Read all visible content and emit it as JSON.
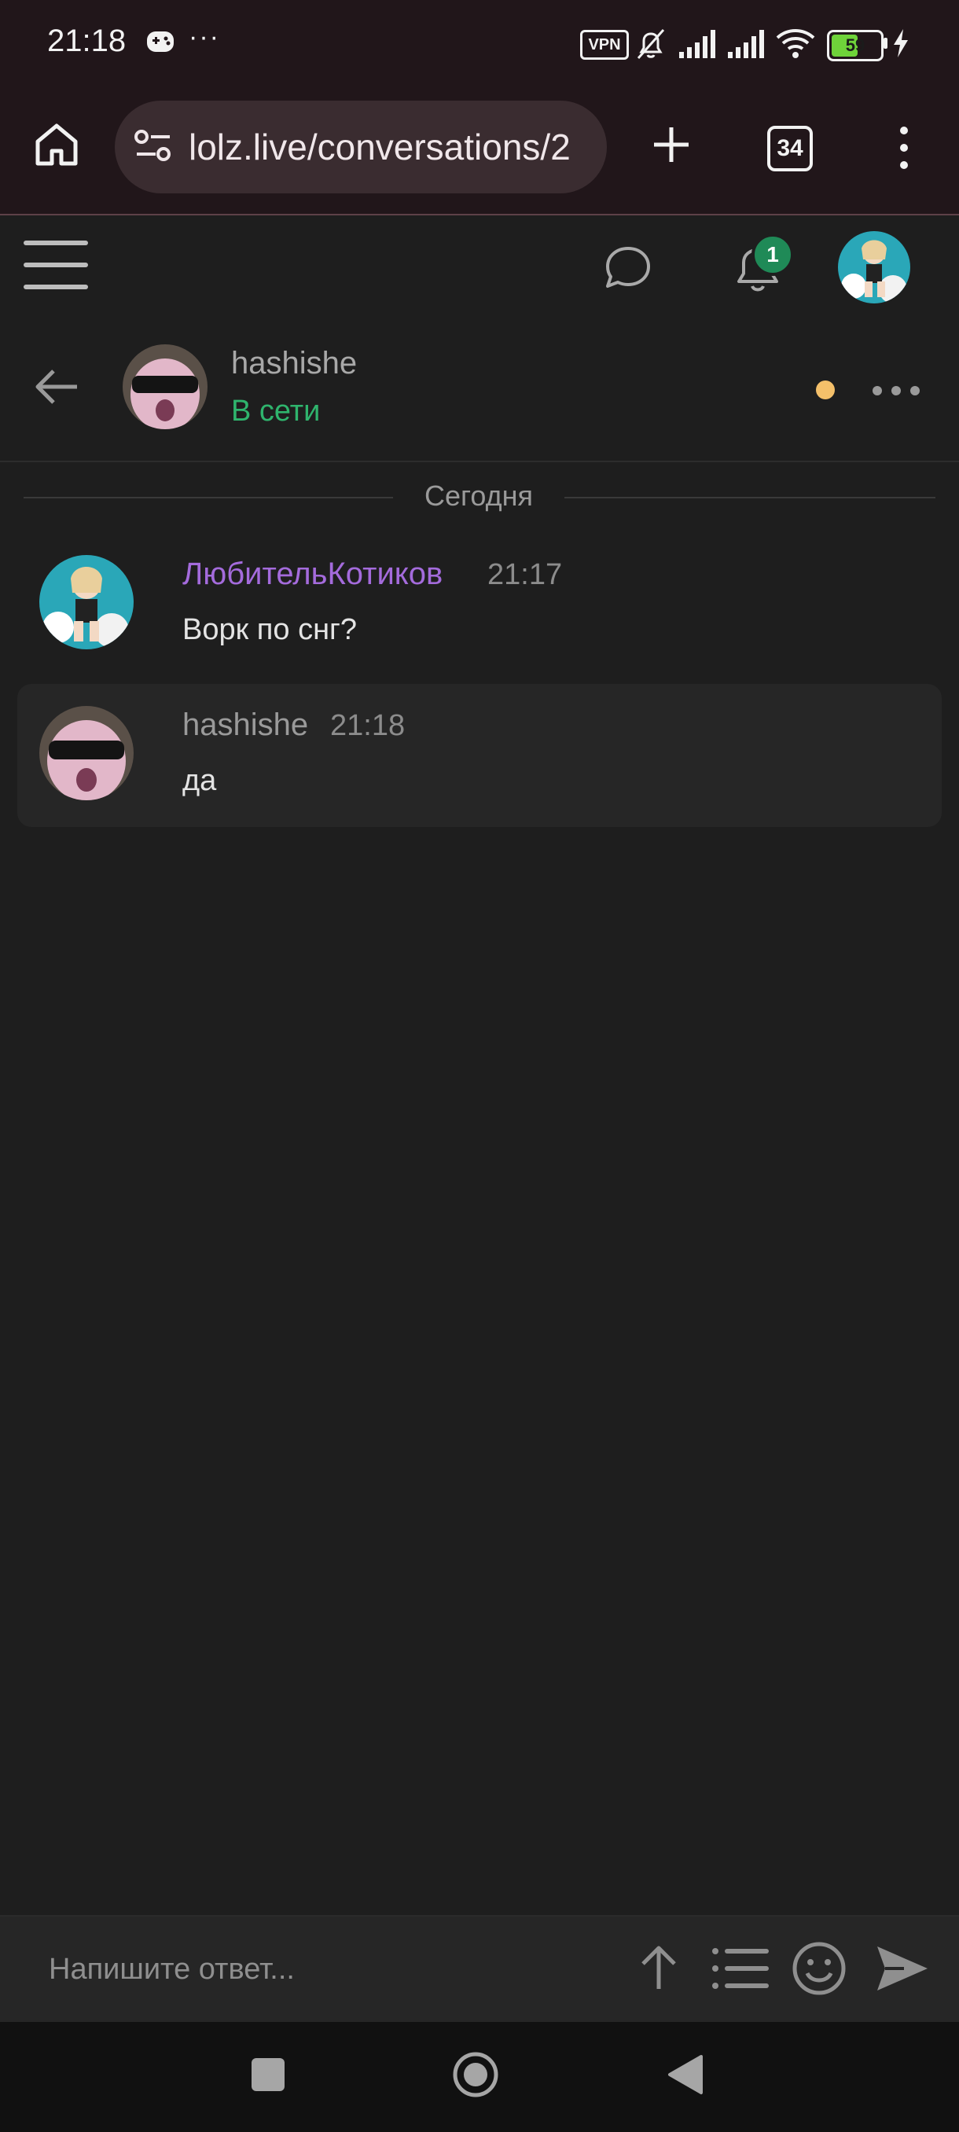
{
  "status_bar": {
    "time": "21:18",
    "more": "···",
    "vpn": "VPN",
    "battery_level": 59,
    "battery_label": "59",
    "icons": [
      "gamepad-icon",
      "bell-off-icon",
      "signal-icon",
      "signal-icon",
      "wifi-icon",
      "battery-icon",
      "charging-icon"
    ]
  },
  "browser": {
    "url": "lolz.live/conversations/2",
    "tabs_count": "34",
    "icons": [
      "home-icon",
      "site-settings-icon",
      "plus-icon",
      "kebab-icon"
    ]
  },
  "site_header": {
    "notifications_count": "1",
    "icons": [
      "hamburger-icon",
      "chat-bubble-icon",
      "bell-icon",
      "avatar"
    ]
  },
  "conversation": {
    "username": "hashishe",
    "status": "В сети",
    "date_divider": "Сегодня"
  },
  "messages": [
    {
      "author": "ЛюбительКотиков",
      "time": "21:17",
      "text": "Ворк по снг?",
      "author_color": "#a46bdc"
    },
    {
      "author": "hashishe",
      "time": "21:18",
      "text": "да",
      "author_color": "#9a9a9a"
    }
  ],
  "reply": {
    "placeholder": "Напишите ответ...",
    "icons": [
      "arrow-up-icon",
      "list-icon",
      "emoji-icon",
      "send-icon"
    ]
  },
  "colors": {
    "background": "#1e1e1e",
    "online": "#2fb46d",
    "accent_purple": "#a46bdc",
    "badge": "#1f8a57"
  }
}
